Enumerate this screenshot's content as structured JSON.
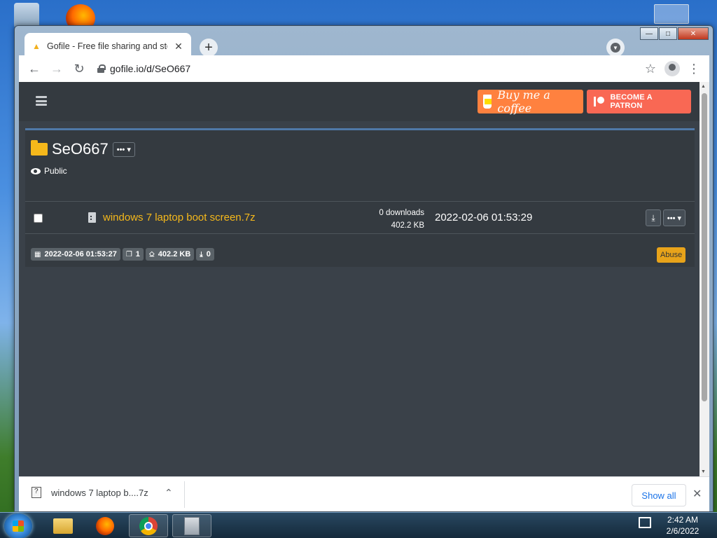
{
  "browser": {
    "tab_title": "Gofile - Free file sharing and sto",
    "address": "gofile.io/d/SeO667"
  },
  "page": {
    "coffee_label": "Buy me a coffee",
    "patron_label": "BECOME A PATRON",
    "folder_name": "SeO667",
    "folder_menu": "••• ▾",
    "visibility": "Public",
    "file": {
      "name": "windows 7 laptop boot screen.7z",
      "downloads": "0 downloads",
      "size": "402.2 KB",
      "date": "2022-02-06 01:53:29"
    },
    "stats": {
      "created": "2022-02-06 01:53:27",
      "files": "1",
      "total_size": "402.2 KB",
      "downloads": "0"
    },
    "abuse_label": "Abuse"
  },
  "download_shelf": {
    "item": "windows 7 laptop b....7z",
    "show_all": "Show all"
  },
  "taskbar": {
    "time": "2:42 AM",
    "date": "2/6/2022"
  },
  "colors": {
    "accent_yellow": "#f5b81b",
    "page_bg": "#3a4149",
    "navbar_bg": "#343a40",
    "coffee": "#ff813f",
    "patron": "#f96854"
  }
}
